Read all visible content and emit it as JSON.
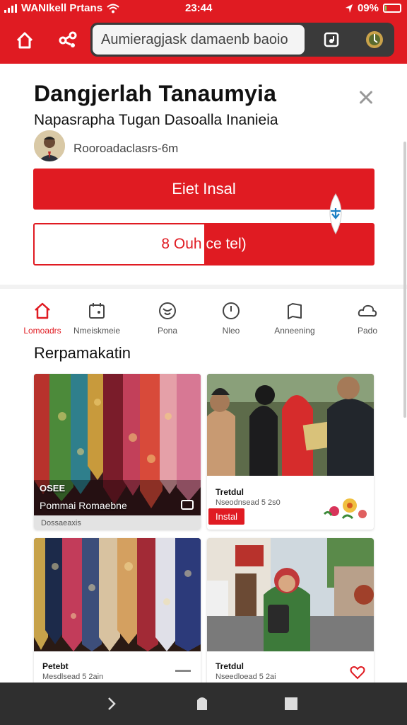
{
  "status_bar": {
    "carrier": "WANIkell Prtans",
    "time": "23:44",
    "battery": "09%",
    "battery_level": 0.09
  },
  "toolbar": {
    "home_icon": "home-icon",
    "share_icon": "share-icon",
    "url_text": "Aumieragjask damaenb baoio",
    "tab_icon": "tab-switcher-icon",
    "menu_icon": "menu-icon"
  },
  "app": {
    "title": "Dangjerlah Tanaumyia",
    "subtitle": "Napasrapha Tugan Dasoalla Inanieia",
    "author": "Rooroadaclasrs-6m",
    "install_label": "Eiet Insal",
    "secondary_label_left": "8 Ouh",
    "secondary_label_right": "ce tel)",
    "secondary_progress": 0.5
  },
  "categories": [
    {
      "label": "Lomoadrs",
      "icon": "home-icon",
      "active": true
    },
    {
      "label": "Nmeiskmeie",
      "icon": "calendar-icon",
      "active": false
    },
    {
      "label": "Pona",
      "icon": "flower-icon",
      "active": false
    },
    {
      "label": "Nleo",
      "icon": "clock-icon",
      "active": false
    },
    {
      "label": "Anneening",
      "icon": "book-icon",
      "active": false
    },
    {
      "label": "Pado",
      "icon": "cloud-icon",
      "active": false
    }
  ],
  "section": {
    "title": "Rerpamakatin"
  },
  "tiles": [
    {
      "overlay_small": "OSEE",
      "overlay_title": "Pommai Romaebne",
      "footer": "Dossaeaxis"
    },
    {
      "title": "Tretdul",
      "sub": "Nseodnsead 5 2s0",
      "badge": "Instal"
    },
    {
      "title": "Petebt",
      "sub": "Mesdlsead 5 2ain"
    },
    {
      "title": "Tretdul",
      "sub": "Nseedloead 5 2ai"
    }
  ],
  "colors": {
    "brand_red": "#e01b22",
    "nav_dark": "#2f2f2f"
  }
}
